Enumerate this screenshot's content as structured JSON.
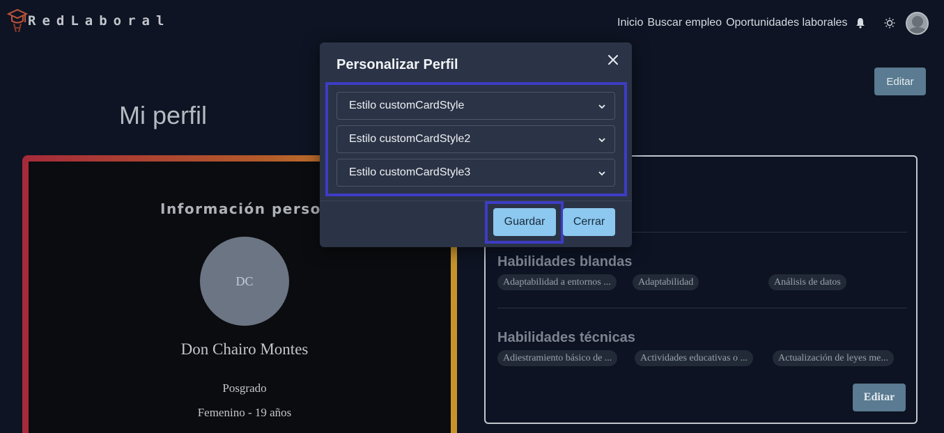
{
  "navbar": {
    "brand": "RedLaboral",
    "links": [
      "Inicio",
      "Buscar empleo",
      "Oportunidades laborales"
    ],
    "icons": [
      "bell-icon",
      "sun-icon",
      "avatar"
    ]
  },
  "page": {
    "title": "Mi perfil",
    "edit_top": "Editar"
  },
  "left_card": {
    "heading": "Información personal",
    "initials": "DC",
    "name": "Don Chairo Montes",
    "level": "Posgrado",
    "gender_age": "Femenino - 19 años"
  },
  "right_card": {
    "soft_skills_title": "Habilidades blandas",
    "soft_skills": [
      "Adaptabilidad a entornos ...",
      "Adaptabilidad",
      "Análisis de datos"
    ],
    "tech_skills_title": "Habilidades técnicas",
    "tech_skills": [
      "Adiestramiento básico de ...",
      "Actividades educativas o ...",
      "Actualización de leyes me..."
    ],
    "edit_label": "Editar"
  },
  "modal": {
    "title": "Personalizar Perfil",
    "selects": [
      "Estilo customCardStyle",
      "Estilo customCardStyle2",
      "Estilo customCardStyle3"
    ],
    "save_label": "Guardar",
    "close_label": "Cerrar"
  },
  "colors": {
    "background": "#0e1423",
    "modal_bg": "#2b3446",
    "highlight": "#3e3cc4",
    "button": "#8cc8ef",
    "edit_button": "#5a7b91"
  }
}
